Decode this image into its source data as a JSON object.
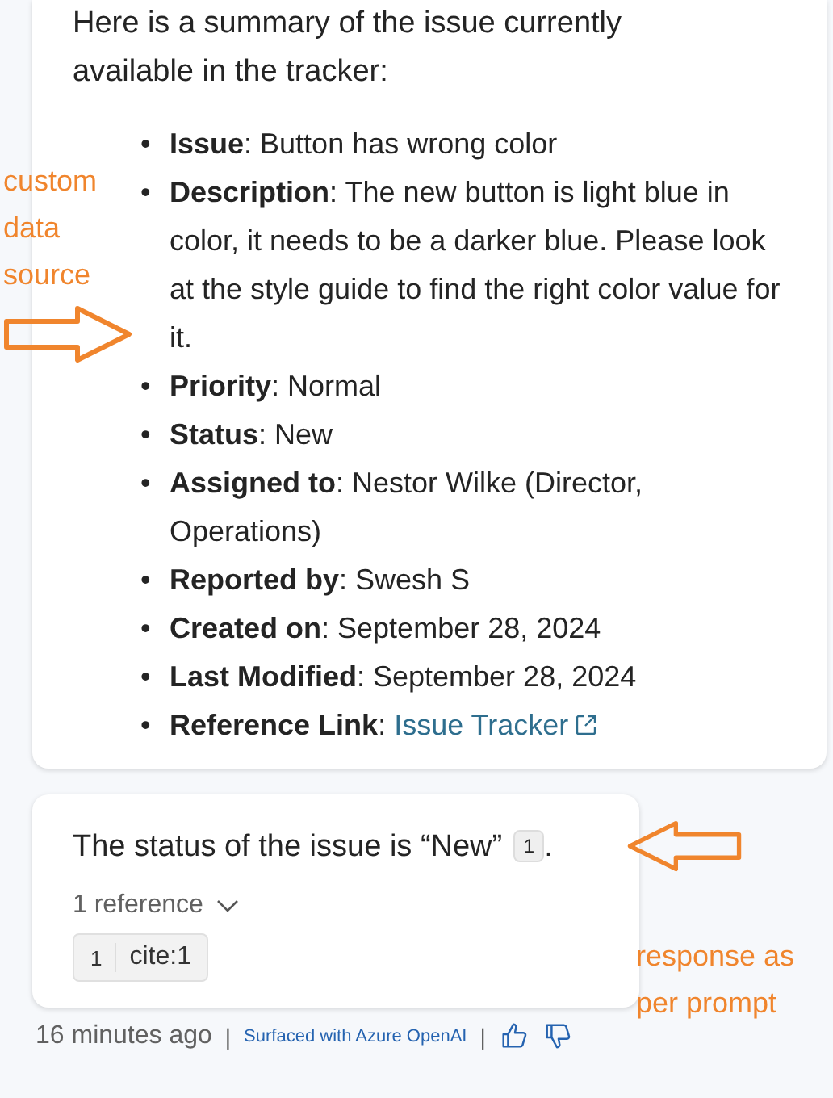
{
  "summary_card": {
    "intro": "Here is a summary of the issue currently available in the tracker:",
    "fields": [
      {
        "kind": "text",
        "bullet": "•",
        "label": "Issue",
        "separator": ":",
        "value": "Button has wrong color"
      },
      {
        "kind": "text",
        "bullet": "•",
        "label": "Description",
        "separator": ":",
        "value": "The new button is light blue in color, it needs to be a darker blue. Please look at the style guide to find the right color value for it."
      },
      {
        "kind": "text",
        "bullet": "•",
        "label": "Priority",
        "separator": ":",
        "value": "Normal"
      },
      {
        "kind": "text",
        "bullet": "•",
        "label": "Status",
        "separator": ":",
        "value": "New"
      },
      {
        "kind": "text",
        "bullet": "•",
        "label": "Assigned to",
        "separator": ":",
        "value": "Nestor Wilke (Director, Operations)"
      },
      {
        "kind": "text",
        "bullet": "•",
        "label": "Reported by",
        "separator": ":",
        "value": "Swesh S"
      },
      {
        "kind": "text",
        "bullet": "•",
        "label": "Created on",
        "separator": ":",
        "value": "September 28, 2024"
      },
      {
        "kind": "text",
        "bullet": "•",
        "label": "Last Modified",
        "separator": ":",
        "value": "September 28, 2024"
      },
      {
        "kind": "link",
        "bullet": "•",
        "label": "Reference Link",
        "separator": ":",
        "value": "Issue Tracker"
      }
    ]
  },
  "answer_card": {
    "text": "The status of the issue is “New”",
    "citation": "1",
    "end": ".",
    "references_toggle": "1 reference",
    "references": [
      {
        "number": "1",
        "title": "cite:1"
      }
    ]
  },
  "footer": {
    "time": "16 minutes ago",
    "separator": "|",
    "surfaced": "Surfaced with Azure OpenAI",
    "separator_2": "|"
  },
  "annotations": [
    {
      "text": "custom data source",
      "kind": "right-arrow"
    },
    {
      "text": "response as per prompt",
      "kind": "left-arrow"
    }
  ]
}
